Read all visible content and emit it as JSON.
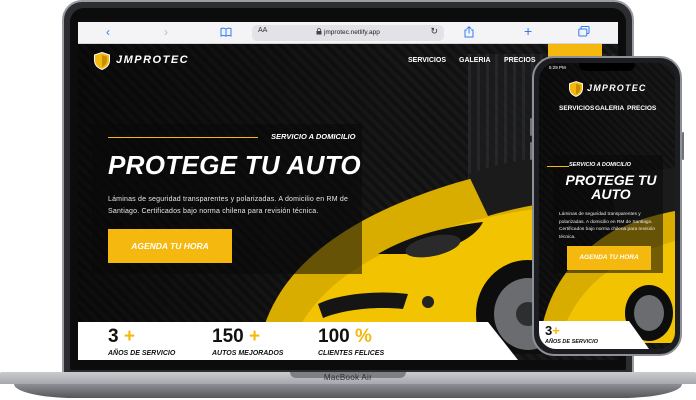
{
  "device_label": "MacBook Air",
  "browser": {
    "text_size_label": "AA",
    "url": "jmprotec.netlify.app",
    "back_icon": "chevron-left-icon",
    "forward_icon": "chevron-right-icon",
    "bookmarks_icon": "book-icon",
    "reload_icon": "reload-icon",
    "share_icon": "share-icon",
    "new_tab_icon": "plus-icon",
    "tabs_icon": "tabs-icon"
  },
  "site": {
    "brand": "JMPROTEC",
    "nav": [
      "SERVICIOS",
      "GALERIA",
      "PRECIOS"
    ],
    "hero": {
      "tag": "SERVICIO A DOMICILIO",
      "title": "PROTEGE TU AUTO",
      "description": "Láminas de seguridad transparentes y polarizadas. A domicilio en RM de Santiago. Certificados bajo norma chilena para revisión técnica.",
      "cta": "AGENDA TU HORA"
    },
    "stats": [
      {
        "number": "3",
        "suffix": "+",
        "label": "AÑOS DE SERVICIO"
      },
      {
        "number": "150",
        "suffix": "+",
        "label": "AUTOS MEJORADOS"
      },
      {
        "number": "100",
        "suffix": "%",
        "label": "CLIENTES FELICES"
      }
    ]
  },
  "phone": {
    "time": "5:29 PM",
    "brand": "JMPROTEC",
    "nav": [
      "SERVICIOS",
      "GALERIA",
      "PRECIOS"
    ],
    "hero": {
      "tag": "SERVICIO A DOMICILIO",
      "title": "PROTEGE TU AUTO",
      "description": "Láminas de seguridad transparentes y polarizadas. A domicilio en RM de Santiago. Certificados bajo norma chilena para revisión técnica.",
      "cta": "AGENDA TU HORA"
    },
    "stat": {
      "number": "3",
      "suffix": "+",
      "label": "AÑOS DE SERVICIO"
    }
  },
  "colors": {
    "accent": "#f4b80e",
    "background": "#0b0b0c",
    "car": "#f2c300"
  }
}
